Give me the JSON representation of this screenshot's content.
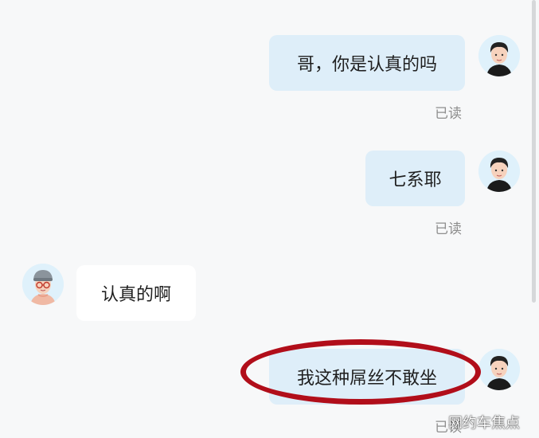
{
  "messages": [
    {
      "direction": "outgoing",
      "text": "哥，你是认真的吗",
      "receipt": "已读"
    },
    {
      "direction": "outgoing",
      "text": "七系耶",
      "receipt": "已读"
    },
    {
      "direction": "incoming",
      "text": "认真的啊"
    },
    {
      "direction": "outgoing",
      "text": "我这种屌丝不敢坐",
      "receipt": "已读"
    }
  ],
  "watermark": "网约车焦点",
  "colors": {
    "outgoing_bubble": "#deeef9",
    "incoming_bubble": "#ffffff",
    "highlight_ring": "#b10e1a",
    "background": "#f7f8f9"
  },
  "icons": {
    "self_avatar": "man-avatar-icon",
    "peer_avatar": "cap-glasses-avatar-icon"
  }
}
